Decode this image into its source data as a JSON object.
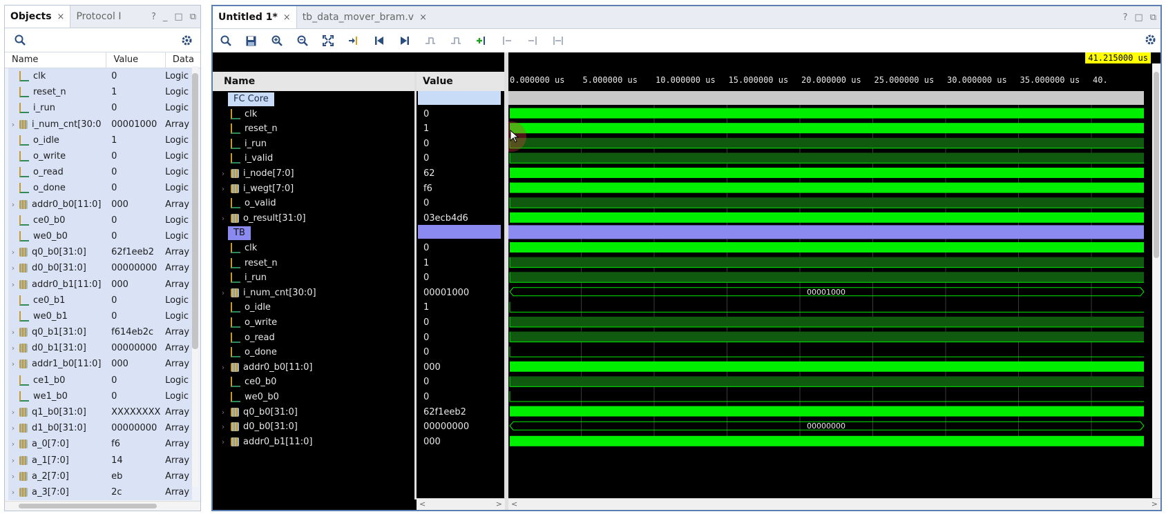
{
  "objects_panel": {
    "tabs": [
      {
        "label": "Objects",
        "close": "×"
      },
      {
        "label": "Protocol I"
      }
    ],
    "window_controls": [
      "?",
      "_",
      "□",
      "⧉"
    ],
    "columns": [
      "Name",
      "Value",
      "Data"
    ],
    "rows": [
      {
        "name": "clk",
        "value": "0",
        "type": "Logic",
        "kind": "logic",
        "expandable": false
      },
      {
        "name": "reset_n",
        "value": "1",
        "type": "Logic",
        "kind": "logic",
        "expandable": false
      },
      {
        "name": "i_run",
        "value": "0",
        "type": "Logic",
        "kind": "logic",
        "expandable": false
      },
      {
        "name": "i_num_cnt[30:0",
        "value": "00001000",
        "type": "Array",
        "kind": "bus",
        "expandable": true
      },
      {
        "name": "o_idle",
        "value": "1",
        "type": "Logic",
        "kind": "logic",
        "expandable": false
      },
      {
        "name": "o_write",
        "value": "0",
        "type": "Logic",
        "kind": "logic",
        "expandable": false
      },
      {
        "name": "o_read",
        "value": "0",
        "type": "Logic",
        "kind": "logic",
        "expandable": false
      },
      {
        "name": "o_done",
        "value": "0",
        "type": "Logic",
        "kind": "logic",
        "expandable": false
      },
      {
        "name": "addr0_b0[11:0]",
        "value": "000",
        "type": "Array",
        "kind": "bus",
        "expandable": true
      },
      {
        "name": "ce0_b0",
        "value": "0",
        "type": "Logic",
        "kind": "logic",
        "expandable": false
      },
      {
        "name": "we0_b0",
        "value": "0",
        "type": "Logic",
        "kind": "logic",
        "expandable": false
      },
      {
        "name": "q0_b0[31:0]",
        "value": "62f1eeb2",
        "type": "Array",
        "kind": "bus",
        "expandable": true
      },
      {
        "name": "d0_b0[31:0]",
        "value": "00000000",
        "type": "Array",
        "kind": "bus",
        "expandable": true
      },
      {
        "name": "addr0_b1[11:0]",
        "value": "000",
        "type": "Array",
        "kind": "bus",
        "expandable": true
      },
      {
        "name": "ce0_b1",
        "value": "0",
        "type": "Logic",
        "kind": "logic",
        "expandable": false
      },
      {
        "name": "we0_b1",
        "value": "0",
        "type": "Logic",
        "kind": "logic",
        "expandable": false
      },
      {
        "name": "q0_b1[31:0]",
        "value": "f614eb2c",
        "type": "Array",
        "kind": "bus",
        "expandable": true
      },
      {
        "name": "d0_b1[31:0]",
        "value": "00000000",
        "type": "Array",
        "kind": "bus",
        "expandable": true
      },
      {
        "name": "addr1_b0[11:0]",
        "value": "000",
        "type": "Array",
        "kind": "bus",
        "expandable": true
      },
      {
        "name": "ce1_b0",
        "value": "0",
        "type": "Logic",
        "kind": "logic",
        "expandable": false
      },
      {
        "name": "we1_b0",
        "value": "0",
        "type": "Logic",
        "kind": "logic",
        "expandable": false
      },
      {
        "name": "q1_b0[31:0]",
        "value": "XXXXXXXX",
        "type": "Array",
        "kind": "bus",
        "expandable": true
      },
      {
        "name": "d1_b0[31:0]",
        "value": "00000000",
        "type": "Array",
        "kind": "bus",
        "expandable": true
      },
      {
        "name": "a_0[7:0]",
        "value": "f6",
        "type": "Array",
        "kind": "bus",
        "expandable": true
      },
      {
        "name": "a_1[7:0]",
        "value": "14",
        "type": "Array",
        "kind": "bus",
        "expandable": true
      },
      {
        "name": "a_2[7:0]",
        "value": "eb",
        "type": "Array",
        "kind": "bus",
        "expandable": true
      },
      {
        "name": "a_3[7:0]",
        "value": "2c",
        "type": "Array",
        "kind": "bus",
        "expandable": true
      }
    ]
  },
  "wave_window": {
    "tabs": [
      {
        "label": "Untitled 1*",
        "close": "×"
      },
      {
        "label": "tb_data_mover_bram.v",
        "close": "×"
      }
    ],
    "window_controls": [
      "?",
      "□",
      "⧉"
    ],
    "name_header": "Name",
    "value_header": "Value",
    "cursor_time": "41.215000 us",
    "time_ticks": [
      "0.000000 us",
      "5.000000 us",
      "10.000000 us",
      "15.000000 us",
      "20.000000 us",
      "25.000000 us",
      "30.000000 us",
      "35.000000 us",
      "40."
    ],
    "signals": [
      {
        "name": "FC Core",
        "value": "",
        "kind": "group",
        "color": "#c9dcf7"
      },
      {
        "name": "clk",
        "value": "0",
        "kind": "clock",
        "expandable": false
      },
      {
        "name": "reset_n",
        "value": "1",
        "kind": "high",
        "expandable": false
      },
      {
        "name": "i_run",
        "value": "0",
        "kind": "low",
        "expandable": false
      },
      {
        "name": "i_valid",
        "value": "0",
        "kind": "low",
        "expandable": false
      },
      {
        "name": "i_node[7:0]",
        "value": "62",
        "kind": "busfill",
        "expandable": true
      },
      {
        "name": "i_wegt[7:0]",
        "value": "f6",
        "kind": "busfill",
        "expandable": true
      },
      {
        "name": "o_valid",
        "value": "0",
        "kind": "low",
        "expandable": false
      },
      {
        "name": "o_result[31:0]",
        "value": "03ecb4d6",
        "kind": "busfill",
        "expandable": true
      },
      {
        "name": "TB",
        "value": "",
        "kind": "group",
        "color": "#8a8af0"
      },
      {
        "name": "clk",
        "value": "0",
        "kind": "clock",
        "expandable": false
      },
      {
        "name": "reset_n",
        "value": "1",
        "kind": "low",
        "expandable": false
      },
      {
        "name": "i_run",
        "value": "0",
        "kind": "low",
        "expandable": false
      },
      {
        "name": "i_num_cnt[30:0]",
        "value": "00001000",
        "kind": "busval",
        "buslabel": "00001000",
        "expandable": true
      },
      {
        "name": "o_idle",
        "value": "1",
        "kind": "flat",
        "expandable": false
      },
      {
        "name": "o_write",
        "value": "0",
        "kind": "low",
        "expandable": false
      },
      {
        "name": "o_read",
        "value": "0",
        "kind": "low",
        "expandable": false
      },
      {
        "name": "o_done",
        "value": "0",
        "kind": "flat",
        "expandable": false
      },
      {
        "name": "addr0_b0[11:0]",
        "value": "000",
        "kind": "busfill",
        "expandable": true
      },
      {
        "name": "ce0_b0",
        "value": "0",
        "kind": "low",
        "expandable": false
      },
      {
        "name": "we0_b0",
        "value": "0",
        "kind": "flat",
        "expandable": false
      },
      {
        "name": "q0_b0[31:0]",
        "value": "62f1eeb2",
        "kind": "busfill",
        "expandable": true
      },
      {
        "name": "d0_b0[31:0]",
        "value": "00000000",
        "kind": "busval",
        "buslabel": "00000000",
        "expandable": true
      },
      {
        "name": "addr0_b1[11:0]",
        "value": "000",
        "kind": "busfill",
        "expandable": true
      }
    ],
    "colors": {
      "wave_green": "#00ee00",
      "wave_dark_green": "#0f5a0f",
      "group_gray": "#c8c8c8",
      "tb_band": "#8a8af0",
      "cursor_label_bg": "#ffff00"
    },
    "toolbar_icons": [
      "search-icon",
      "save-icon",
      "zoom-in-icon",
      "zoom-out-icon",
      "zoom-fit-icon",
      "goto-cursor-icon",
      "goto-start-icon",
      "goto-end-icon",
      "prev-transition-icon",
      "next-transition-icon",
      "add-marker-icon",
      "prev-marker-icon",
      "next-marker-icon",
      "swap-cursors-icon",
      "settings-icon"
    ]
  }
}
